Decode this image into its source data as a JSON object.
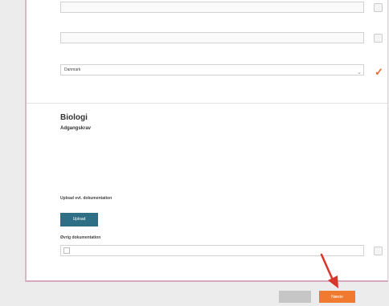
{
  "form": {
    "field1": {
      "value": ""
    },
    "field2": {
      "label": "",
      "placeholder": ""
    },
    "country": {
      "label": "",
      "value": "Danmark"
    }
  },
  "biologi": {
    "title": "Biologi",
    "subtitle": "Adgangskrav",
    "description": ""
  },
  "upload": {
    "label": "Upload evt. dokumentation",
    "hint": "",
    "button_label": "Upload"
  },
  "other": {
    "label": "Øvrig dokumentation",
    "checkbox_text": ""
  },
  "footer": {
    "prev_label": "",
    "next_label": "Næste"
  },
  "colors": {
    "accent": "#f07a30",
    "upload_button": "#2f6f86",
    "card_border": "#d4a8c0"
  }
}
